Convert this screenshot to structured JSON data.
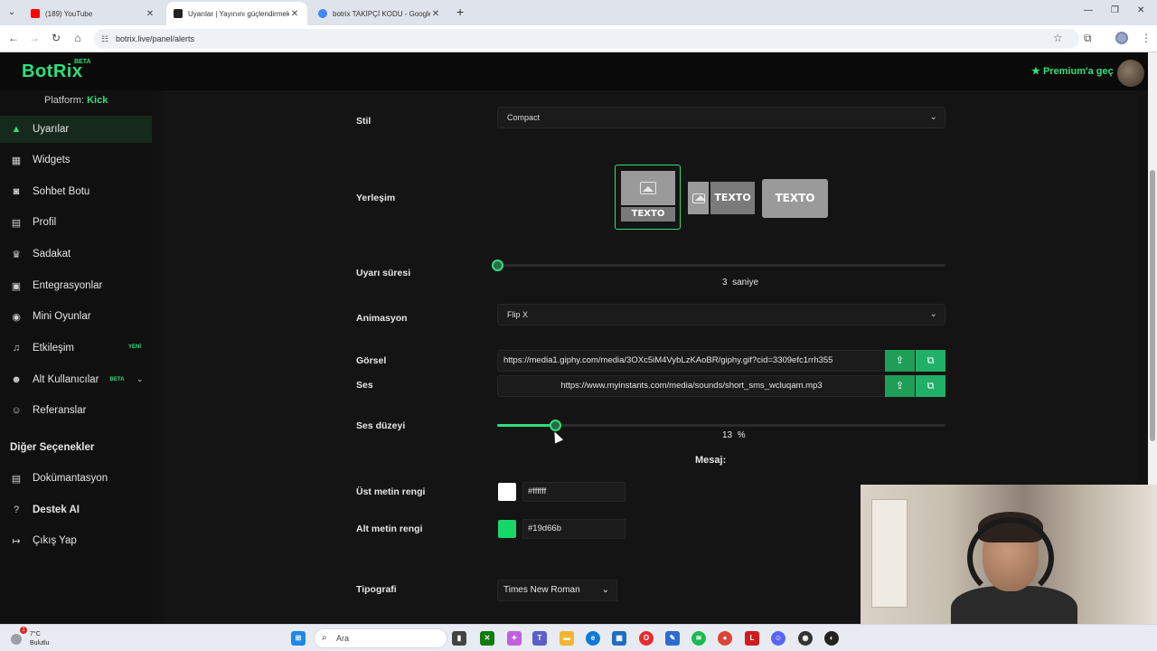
{
  "browser": {
    "tabs": [
      {
        "title": "(189) YouTube",
        "favicon_color": "#ff0000"
      },
      {
        "title": "Uyarılar | Yayınını güçlendirmek",
        "favicon_color": "#222222"
      },
      {
        "title": "botrix TAKİPÇİ KODU - Google",
        "favicon_color": "#4285f4"
      }
    ],
    "url": "botrix.live/panel/alerts"
  },
  "header": {
    "logo": "BotRix",
    "logo_badge": "BETA",
    "premium_label": "Premium'a geç"
  },
  "sidebar": {
    "platform_label": "Platform:",
    "platform_value": "Kick",
    "items": [
      {
        "label": "Uyarılar",
        "icon": "warning-icon",
        "glyph": "▲"
      },
      {
        "label": "Widgets",
        "icon": "widgets-icon",
        "glyph": "▦"
      },
      {
        "label": "Sohbet Botu",
        "icon": "robot-icon",
        "glyph": "◙"
      },
      {
        "label": "Profil",
        "icon": "id-card-icon",
        "glyph": "▤"
      },
      {
        "label": "Sadakat",
        "icon": "trophy-icon",
        "glyph": "♛"
      },
      {
        "label": "Entegrasyonlar",
        "icon": "integrations-icon",
        "glyph": "▣"
      },
      {
        "label": "Mini Oyunlar",
        "icon": "gamepad-icon",
        "glyph": "◉"
      },
      {
        "label": "Etkileşim",
        "icon": "music-icon",
        "glyph": "♫",
        "badge": "YENİ"
      },
      {
        "label": "Alt Kullanıcılar",
        "icon": "users-icon",
        "glyph": "☻",
        "badge": "BETA"
      },
      {
        "label": "Referanslar",
        "icon": "user-plus-icon",
        "glyph": "☺"
      }
    ],
    "section_title": "Diğer Seçenekler",
    "other_items": [
      {
        "label": "Dokümantasyon",
        "icon": "book-icon",
        "glyph": "▤"
      },
      {
        "label": "Destek AI",
        "icon": "question-icon",
        "glyph": "?"
      },
      {
        "label": "Çıkış Yap",
        "icon": "logout-icon",
        "glyph": "↦"
      }
    ]
  },
  "form": {
    "style_label": "Stil",
    "style_value": "Compact",
    "layout_label": "Yerleşim",
    "layout_text": "TEXTO",
    "duration_label": "Uyarı süresi",
    "duration_value": "3",
    "duration_unit": "saniye",
    "duration_fraction": 0.0,
    "animation_label": "Animasyon",
    "animation_value": "Flip X",
    "image_label": "Görsel",
    "image_url": "https://media1.giphy.com/media/3OXc5iM4VybLzKAoBR/giphy.gif?cid=3309efc1rrh355",
    "sound_label": "Ses",
    "sound_url": "https://www.myinstants.com/media/sounds/short_sms_wcluqam.mp3",
    "volume_label": "Ses düzeyi",
    "volume_value": "13",
    "volume_unit": "%",
    "volume_fraction": 0.13,
    "message_heading": "Mesaj:",
    "top_color_label": "Üst metin rengi",
    "top_color": "#ffffff",
    "bottom_color_label": "Alt metin rengi",
    "bottom_color": "#19d66b",
    "typography_label": "Tipografi",
    "typography_value": "Times New Roman"
  },
  "taskbar": {
    "temperature": "7°C",
    "weather": "Bulutlu",
    "notification_count": "1",
    "search_placeholder": "Ara"
  },
  "colors": {
    "accent": "#2ee07a",
    "background": "#141414"
  }
}
